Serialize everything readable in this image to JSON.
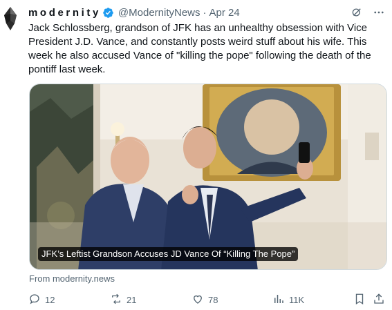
{
  "author": {
    "display_name": "modernity",
    "handle": "@ModernityNews",
    "separator": "·",
    "date": "Apr 24"
  },
  "tweet": {
    "text": "Jack Schlossberg, grandson of JFK has an unhealthy obsession with Vice President J.D. Vance, and constantly posts weird stuff about his wife. This week he also accused Vance of \"killing the pope\" following the death of the pontiff last week."
  },
  "media": {
    "caption": "JFK’s Leftist Grandson Accuses JD Vance Of “Killing The Pope”"
  },
  "source": {
    "text": "From modernity.news"
  },
  "actions": {
    "replies": "12",
    "reposts": "21",
    "likes": "78",
    "views": "11K"
  },
  "icons": {
    "verified": "verified-badge-icon",
    "grok": "grok-icon",
    "more": "more-icon",
    "reply": "reply-icon",
    "repost": "repost-icon",
    "like": "like-icon",
    "views": "views-icon",
    "bookmark": "bookmark-icon",
    "share": "share-icon"
  },
  "colors": {
    "accent": "#1d9bf0",
    "secondary_text": "#536471",
    "primary_text": "#0f1419"
  }
}
